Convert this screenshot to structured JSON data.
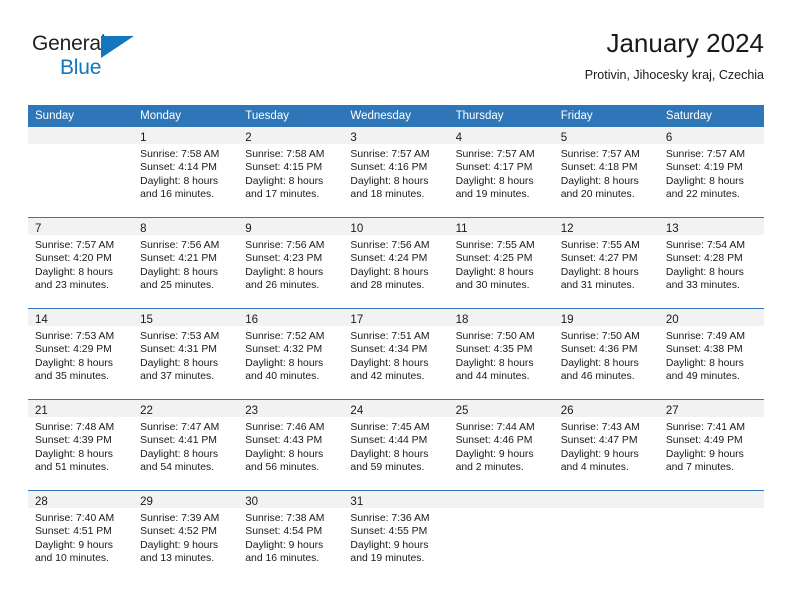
{
  "logo": {
    "word_one": "General",
    "word_two": "Blue",
    "accent_color": "#1277bf",
    "triangle_icon": "triangle-icon"
  },
  "header": {
    "title": "January 2024",
    "subtitle": "Protivin, Jihocesky kraj, Czechia"
  },
  "calendar": {
    "header_color": "#2e76b8",
    "daynum_band_color": "#f2f2f2",
    "weekday_headers": [
      "Sunday",
      "Monday",
      "Tuesday",
      "Wednesday",
      "Thursday",
      "Friday",
      "Saturday"
    ],
    "weeks": [
      [
        {
          "day": "",
          "sunrise": "",
          "sunset": "",
          "daylight_line1": "",
          "daylight_line2": ""
        },
        {
          "day": "1",
          "sunrise": "Sunrise: 7:58 AM",
          "sunset": "Sunset: 4:14 PM",
          "daylight_line1": "Daylight: 8 hours",
          "daylight_line2": "and 16 minutes."
        },
        {
          "day": "2",
          "sunrise": "Sunrise: 7:58 AM",
          "sunset": "Sunset: 4:15 PM",
          "daylight_line1": "Daylight: 8 hours",
          "daylight_line2": "and 17 minutes."
        },
        {
          "day": "3",
          "sunrise": "Sunrise: 7:57 AM",
          "sunset": "Sunset: 4:16 PM",
          "daylight_line1": "Daylight: 8 hours",
          "daylight_line2": "and 18 minutes."
        },
        {
          "day": "4",
          "sunrise": "Sunrise: 7:57 AM",
          "sunset": "Sunset: 4:17 PM",
          "daylight_line1": "Daylight: 8 hours",
          "daylight_line2": "and 19 minutes."
        },
        {
          "day": "5",
          "sunrise": "Sunrise: 7:57 AM",
          "sunset": "Sunset: 4:18 PM",
          "daylight_line1": "Daylight: 8 hours",
          "daylight_line2": "and 20 minutes."
        },
        {
          "day": "6",
          "sunrise": "Sunrise: 7:57 AM",
          "sunset": "Sunset: 4:19 PM",
          "daylight_line1": "Daylight: 8 hours",
          "daylight_line2": "and 22 minutes."
        }
      ],
      [
        {
          "day": "7",
          "sunrise": "Sunrise: 7:57 AM",
          "sunset": "Sunset: 4:20 PM",
          "daylight_line1": "Daylight: 8 hours",
          "daylight_line2": "and 23 minutes."
        },
        {
          "day": "8",
          "sunrise": "Sunrise: 7:56 AM",
          "sunset": "Sunset: 4:21 PM",
          "daylight_line1": "Daylight: 8 hours",
          "daylight_line2": "and 25 minutes."
        },
        {
          "day": "9",
          "sunrise": "Sunrise: 7:56 AM",
          "sunset": "Sunset: 4:23 PM",
          "daylight_line1": "Daylight: 8 hours",
          "daylight_line2": "and 26 minutes."
        },
        {
          "day": "10",
          "sunrise": "Sunrise: 7:56 AM",
          "sunset": "Sunset: 4:24 PM",
          "daylight_line1": "Daylight: 8 hours",
          "daylight_line2": "and 28 minutes."
        },
        {
          "day": "11",
          "sunrise": "Sunrise: 7:55 AM",
          "sunset": "Sunset: 4:25 PM",
          "daylight_line1": "Daylight: 8 hours",
          "daylight_line2": "and 30 minutes."
        },
        {
          "day": "12",
          "sunrise": "Sunrise: 7:55 AM",
          "sunset": "Sunset: 4:27 PM",
          "daylight_line1": "Daylight: 8 hours",
          "daylight_line2": "and 31 minutes."
        },
        {
          "day": "13",
          "sunrise": "Sunrise: 7:54 AM",
          "sunset": "Sunset: 4:28 PM",
          "daylight_line1": "Daylight: 8 hours",
          "daylight_line2": "and 33 minutes."
        }
      ],
      [
        {
          "day": "14",
          "sunrise": "Sunrise: 7:53 AM",
          "sunset": "Sunset: 4:29 PM",
          "daylight_line1": "Daylight: 8 hours",
          "daylight_line2": "and 35 minutes."
        },
        {
          "day": "15",
          "sunrise": "Sunrise: 7:53 AM",
          "sunset": "Sunset: 4:31 PM",
          "daylight_line1": "Daylight: 8 hours",
          "daylight_line2": "and 37 minutes."
        },
        {
          "day": "16",
          "sunrise": "Sunrise: 7:52 AM",
          "sunset": "Sunset: 4:32 PM",
          "daylight_line1": "Daylight: 8 hours",
          "daylight_line2": "and 40 minutes."
        },
        {
          "day": "17",
          "sunrise": "Sunrise: 7:51 AM",
          "sunset": "Sunset: 4:34 PM",
          "daylight_line1": "Daylight: 8 hours",
          "daylight_line2": "and 42 minutes."
        },
        {
          "day": "18",
          "sunrise": "Sunrise: 7:50 AM",
          "sunset": "Sunset: 4:35 PM",
          "daylight_line1": "Daylight: 8 hours",
          "daylight_line2": "and 44 minutes."
        },
        {
          "day": "19",
          "sunrise": "Sunrise: 7:50 AM",
          "sunset": "Sunset: 4:36 PM",
          "daylight_line1": "Daylight: 8 hours",
          "daylight_line2": "and 46 minutes."
        },
        {
          "day": "20",
          "sunrise": "Sunrise: 7:49 AM",
          "sunset": "Sunset: 4:38 PM",
          "daylight_line1": "Daylight: 8 hours",
          "daylight_line2": "and 49 minutes."
        }
      ],
      [
        {
          "day": "21",
          "sunrise": "Sunrise: 7:48 AM",
          "sunset": "Sunset: 4:39 PM",
          "daylight_line1": "Daylight: 8 hours",
          "daylight_line2": "and 51 minutes."
        },
        {
          "day": "22",
          "sunrise": "Sunrise: 7:47 AM",
          "sunset": "Sunset: 4:41 PM",
          "daylight_line1": "Daylight: 8 hours",
          "daylight_line2": "and 54 minutes."
        },
        {
          "day": "23",
          "sunrise": "Sunrise: 7:46 AM",
          "sunset": "Sunset: 4:43 PM",
          "daylight_line1": "Daylight: 8 hours",
          "daylight_line2": "and 56 minutes."
        },
        {
          "day": "24",
          "sunrise": "Sunrise: 7:45 AM",
          "sunset": "Sunset: 4:44 PM",
          "daylight_line1": "Daylight: 8 hours",
          "daylight_line2": "and 59 minutes."
        },
        {
          "day": "25",
          "sunrise": "Sunrise: 7:44 AM",
          "sunset": "Sunset: 4:46 PM",
          "daylight_line1": "Daylight: 9 hours",
          "daylight_line2": "and 2 minutes."
        },
        {
          "day": "26",
          "sunrise": "Sunrise: 7:43 AM",
          "sunset": "Sunset: 4:47 PM",
          "daylight_line1": "Daylight: 9 hours",
          "daylight_line2": "and 4 minutes."
        },
        {
          "day": "27",
          "sunrise": "Sunrise: 7:41 AM",
          "sunset": "Sunset: 4:49 PM",
          "daylight_line1": "Daylight: 9 hours",
          "daylight_line2": "and 7 minutes."
        }
      ],
      [
        {
          "day": "28",
          "sunrise": "Sunrise: 7:40 AM",
          "sunset": "Sunset: 4:51 PM",
          "daylight_line1": "Daylight: 9 hours",
          "daylight_line2": "and 10 minutes."
        },
        {
          "day": "29",
          "sunrise": "Sunrise: 7:39 AM",
          "sunset": "Sunset: 4:52 PM",
          "daylight_line1": "Daylight: 9 hours",
          "daylight_line2": "and 13 minutes."
        },
        {
          "day": "30",
          "sunrise": "Sunrise: 7:38 AM",
          "sunset": "Sunset: 4:54 PM",
          "daylight_line1": "Daylight: 9 hours",
          "daylight_line2": "and 16 minutes."
        },
        {
          "day": "31",
          "sunrise": "Sunrise: 7:36 AM",
          "sunset": "Sunset: 4:55 PM",
          "daylight_line1": "Daylight: 9 hours",
          "daylight_line2": "and 19 minutes."
        },
        {
          "day": "",
          "sunrise": "",
          "sunset": "",
          "daylight_line1": "",
          "daylight_line2": ""
        },
        {
          "day": "",
          "sunrise": "",
          "sunset": "",
          "daylight_line1": "",
          "daylight_line2": ""
        },
        {
          "day": "",
          "sunrise": "",
          "sunset": "",
          "daylight_line1": "",
          "daylight_line2": ""
        }
      ]
    ]
  }
}
